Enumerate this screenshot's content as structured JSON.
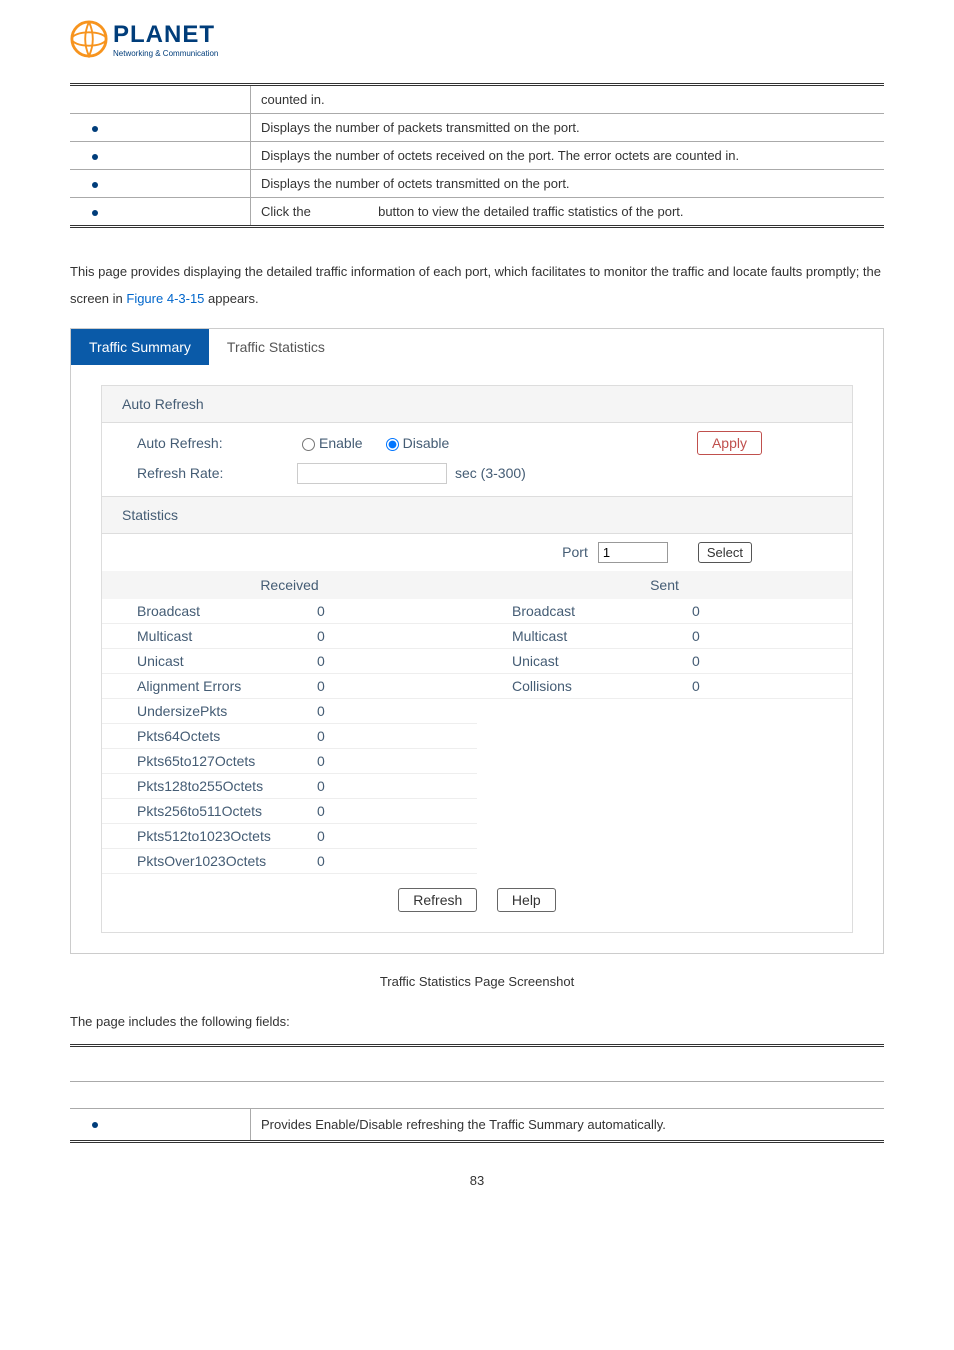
{
  "spec_rows": [
    {
      "label": "",
      "desc": "counted in."
    },
    {
      "label": "•",
      "desc": "Displays the number of packets transmitted on the port."
    },
    {
      "label": "•",
      "desc": "Displays the number of octets received on the port. The error octets are counted in."
    },
    {
      "label": "•",
      "desc": "Displays the number of octets transmitted on the port."
    },
    {
      "label": "•",
      "desc_pre": "Click the ",
      "desc_post": " button to view the detailed traffic statistics of the port."
    }
  ],
  "paragraph_pre": "This page provides displaying the detailed traffic information of each port, which facilitates to monitor the traffic and locate faults promptly; the screen in ",
  "paragraph_link": "Figure 4-3-15",
  "paragraph_post": " appears.",
  "tabs": {
    "tab1": "Traffic Summary",
    "tab2": "Traffic Statistics"
  },
  "panel": {
    "auto_refresh_header": "Auto Refresh",
    "auto_refresh_label": "Auto Refresh:",
    "refresh_rate_label": "Refresh Rate:",
    "enable": "Enable",
    "disable": "Disable",
    "sec_range": "sec (3-300)",
    "apply": "Apply",
    "statistics_header": "Statistics",
    "port_label": "Port",
    "port_value": "1",
    "select": "Select",
    "received": "Received",
    "sent": "Sent",
    "refresh": "Refresh",
    "help": "Help"
  },
  "chart_data": {
    "type": "table",
    "received": [
      {
        "label": "Broadcast",
        "value": "0"
      },
      {
        "label": "Multicast",
        "value": "0"
      },
      {
        "label": "Unicast",
        "value": "0"
      },
      {
        "label": "Alignment Errors",
        "value": "0"
      },
      {
        "label": "UndersizePkts",
        "value": "0"
      },
      {
        "label": "Pkts64Octets",
        "value": "0"
      },
      {
        "label": "Pkts65to127Octets",
        "value": "0"
      },
      {
        "label": "Pkts128to255Octets",
        "value": "0"
      },
      {
        "label": "Pkts256to511Octets",
        "value": "0"
      },
      {
        "label": "Pkts512to1023Octets",
        "value": "0"
      },
      {
        "label": "PktsOver1023Octets",
        "value": "0"
      }
    ],
    "sent": [
      {
        "label": "Broadcast",
        "value": "0"
      },
      {
        "label": "Multicast",
        "value": "0"
      },
      {
        "label": "Unicast",
        "value": "0"
      },
      {
        "label": "Collisions",
        "value": "0"
      }
    ]
  },
  "caption": "Traffic Statistics Page Screenshot",
  "fields_intro": "The page includes the following fields:",
  "fields_row_desc": "Provides Enable/Disable refreshing the Traffic Summary automatically.",
  "page_num": "83"
}
